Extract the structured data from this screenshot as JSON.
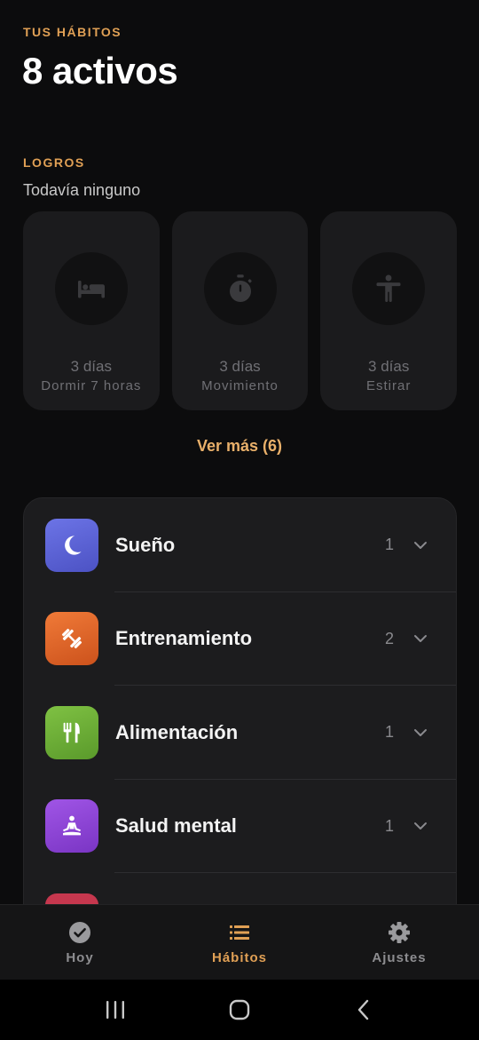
{
  "header": {
    "eyebrow": "TUS HÁBITOS",
    "title": "8 activos"
  },
  "achievements": {
    "eyebrow": "LOGROS",
    "subtitle": "Todavía ninguno",
    "cards": [
      {
        "days": "3 días",
        "name": "Dormir 7 horas",
        "icon": "bed-icon"
      },
      {
        "days": "3 días",
        "name": "Movimiento",
        "icon": "stopwatch-icon"
      },
      {
        "days": "3 días",
        "name": "Estirar",
        "icon": "person-stretch-icon"
      }
    ],
    "more_label": "Ver más (6)"
  },
  "categories": [
    {
      "label": "Sueño",
      "count": "1",
      "icon": "moon-icon",
      "color": "#5b63d8"
    },
    {
      "label": "Entrenamiento",
      "count": "2",
      "icon": "dumbbell-icon",
      "color": "#e0642a"
    },
    {
      "label": "Alimentación",
      "count": "1",
      "icon": "utensils-icon",
      "color": "#6fb03a"
    },
    {
      "label": "Salud mental",
      "count": "1",
      "icon": "meditation-icon",
      "color": "#8e46d6"
    },
    {
      "label": "",
      "count": "",
      "icon": "partial-icon",
      "color": "#c6374e"
    }
  ],
  "nav": {
    "items": [
      {
        "label": "Hoy",
        "icon": "check-circle-icon",
        "active": false
      },
      {
        "label": "Hábitos",
        "icon": "list-icon",
        "active": true
      },
      {
        "label": "Ajustes",
        "icon": "gear-icon",
        "active": false
      }
    ]
  },
  "colors": {
    "accent": "#e0a055",
    "background": "#0c0c0d",
    "card": "#1c1c1e"
  }
}
